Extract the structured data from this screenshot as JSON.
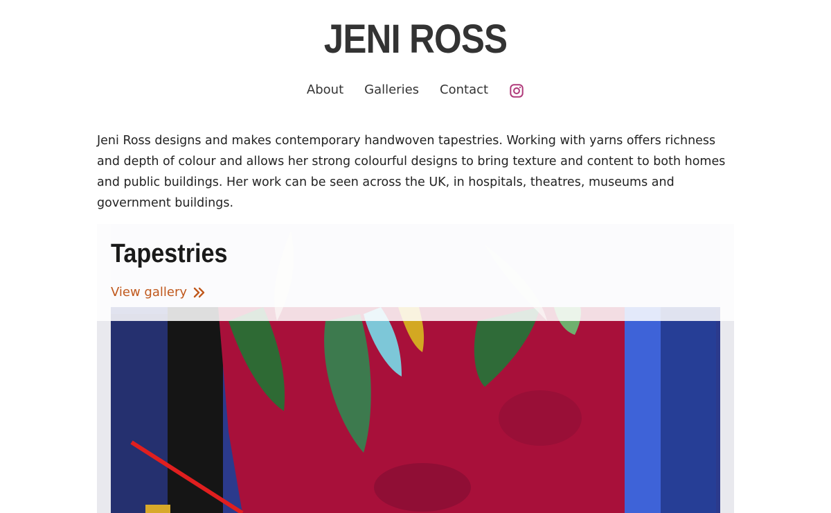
{
  "site": {
    "title": "JENI ROSS"
  },
  "nav": {
    "items": [
      {
        "label": "About"
      },
      {
        "label": "Galleries"
      },
      {
        "label": "Contact"
      }
    ],
    "instagram_icon": "instagram-icon",
    "instagram_color": "#b03a7a"
  },
  "intro": {
    "text": "Jeni Ross designs and makes contemporary handwoven tapestries. Working with yarns offers richness and depth of colour and allows her strong colourful designs to bring texture and content to both homes and public buildings. Her work can be seen across the UK, in hospitals, theatres, museums and government buildings."
  },
  "gallery": {
    "title": "Tapestries",
    "link_label": "View gallery",
    "link_icon": "double-chevron-right-icon",
    "accent_color": "#c0581c"
  }
}
